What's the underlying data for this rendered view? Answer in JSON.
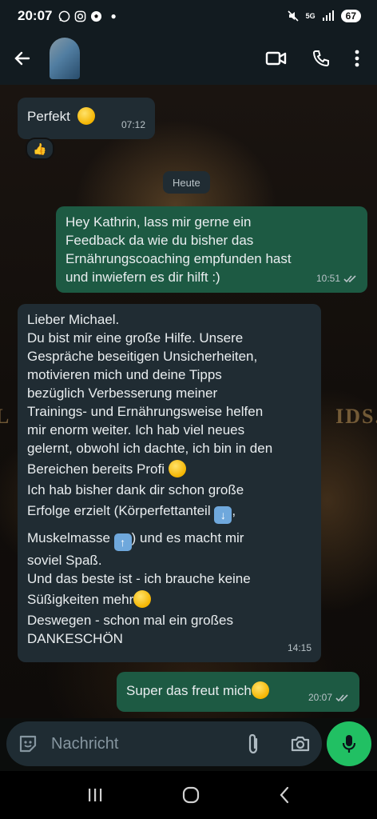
{
  "status_bar": {
    "time": "20:07",
    "network": "5G",
    "battery": "67"
  },
  "header": {
    "contact_name": ""
  },
  "chat": {
    "background_text_left": "L",
    "background_text_right": "IDS.",
    "messages": [
      {
        "direction": "in",
        "text": "Perfekt",
        "time": "07:12",
        "emoji": "smile",
        "reaction": "thumbs-up"
      },
      {
        "type": "date",
        "text": "Heute"
      },
      {
        "direction": "out",
        "lines": [
          "Hey Kathrin, lass mir gerne ein",
          "Feedback da wie du bisher das",
          "Ernährungscoaching empfunden hast",
          "und inwiefern es dir hilft :)"
        ],
        "time": "10:51",
        "status": "read"
      },
      {
        "direction": "in",
        "lines": [
          "Lieber Michael.",
          "Du bist mir eine große Hilfe. Unsere",
          "Gespräche beseitigen Unsicherheiten,",
          "motivieren mich und deine Tipps",
          "bezüglich Verbesserung meiner",
          "Trainings- und Ernährungsweise helfen",
          "mir enorm weiter. Ich hab viel neues",
          "gelernt, obwohl ich dachte, ich bin in den",
          "Bereichen bereits Profi",
          "Ich hab bisher dank dir schon große",
          "Erfolge erzielt (Körperfettanteil",
          "Muskelmasse",
          ") und es macht mir",
          "soviel Spaß.",
          "Und das beste ist - ich brauche keine",
          "Süßigkeiten mehr",
          "Deswegen - schon mal ein großes",
          "DANKESCHÖN"
        ],
        "time": "14:15"
      },
      {
        "direction": "out",
        "text": "Super das freut mich",
        "time": "20:07",
        "status": "read"
      }
    ]
  },
  "input": {
    "placeholder": "Nachricht"
  },
  "colors": {
    "incoming": "#202c33",
    "outgoing": "#1d5a43",
    "accent": "#21c063"
  }
}
